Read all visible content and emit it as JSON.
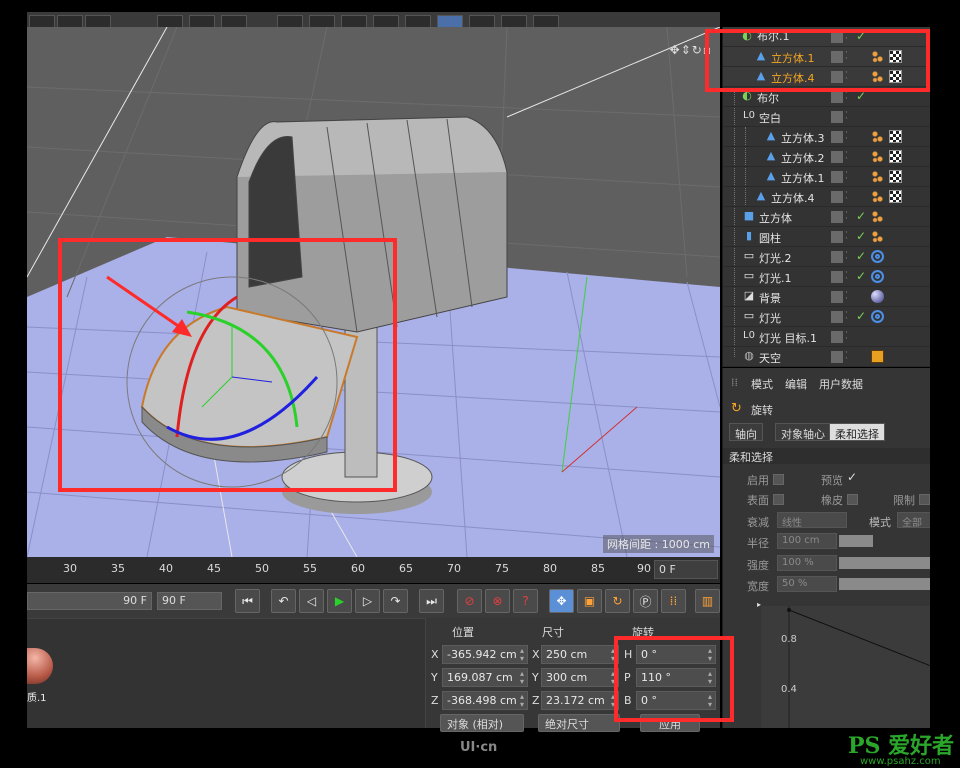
{
  "viewport": {
    "grid_spacing": "网格间距 : 1000 cm"
  },
  "timeline": {
    "ticks": [
      "30",
      "35",
      "40",
      "45",
      "50",
      "55",
      "60",
      "65",
      "70",
      "75",
      "80",
      "85",
      "90"
    ],
    "current_frame": "0 F"
  },
  "transport": {
    "end_frame_slider": "90 F",
    "end_frame_field": "90 F"
  },
  "material": {
    "label": "质.1"
  },
  "coordinates": {
    "headers": {
      "position": "位置",
      "size": "尺寸",
      "rotation": "旋转"
    },
    "rows": [
      {
        "axis": "X",
        "position": "-365.942 cm",
        "size_axis": "X",
        "size": "250 cm",
        "rot_axis": "H",
        "rotation": "0 °"
      },
      {
        "axis": "Y",
        "position": "169.087 cm",
        "size_axis": "Y",
        "size": "300 cm",
        "rot_axis": "P",
        "rotation": "110 °"
      },
      {
        "axis": "Z",
        "position": "-368.498 cm",
        "size_axis": "Z",
        "size": "23.172 cm",
        "rot_axis": "B",
        "rotation": "0 °"
      }
    ],
    "mode_dropdown": "对象 (相对)",
    "size_dropdown": "绝对尺寸",
    "apply_button": "应用"
  },
  "objects": [
    {
      "name": "布尔.1",
      "style": "normal",
      "icon": "boolean-icon",
      "tags": []
    },
    {
      "name": "立方体.1",
      "style": "orange",
      "icon": "polygon-object-icon",
      "tags": [
        "phong",
        "checker"
      ]
    },
    {
      "name": "立方体.4",
      "style": "orange",
      "icon": "polygon-object-icon",
      "tags": [
        "phong",
        "checker"
      ]
    },
    {
      "name": "布尔",
      "style": "normal",
      "icon": "boolean-icon",
      "tags": []
    },
    {
      "name": "空白",
      "style": "normal",
      "icon": "null-object-icon",
      "tags": []
    },
    {
      "name": "立方体.3",
      "style": "normal",
      "icon": "polygon-object-icon",
      "tags": [
        "phong",
        "checker"
      ]
    },
    {
      "name": "立方体.2",
      "style": "normal",
      "icon": "polygon-object-icon",
      "tags": [
        "phong",
        "checker"
      ]
    },
    {
      "name": "立方体.1",
      "style": "normal",
      "icon": "polygon-object-icon",
      "tags": [
        "phong",
        "checker"
      ]
    },
    {
      "name": "立方体.4",
      "style": "normal",
      "icon": "polygon-object-icon",
      "tags": [
        "phong",
        "checker"
      ]
    },
    {
      "name": "立方体",
      "style": "normal",
      "icon": "cube-icon",
      "tags": [
        "phong"
      ]
    },
    {
      "name": "圆柱",
      "style": "normal",
      "icon": "cylinder-icon",
      "tags": [
        "phong"
      ]
    },
    {
      "name": "灯光.2",
      "style": "normal",
      "icon": "light-icon",
      "tags": [
        "target"
      ]
    },
    {
      "name": "灯光.1",
      "style": "normal",
      "icon": "light-icon",
      "tags": [
        "target"
      ]
    },
    {
      "name": "背景",
      "style": "normal",
      "icon": "background-icon",
      "tags": [
        "sphere"
      ]
    },
    {
      "name": "灯光",
      "style": "normal",
      "icon": "light-icon",
      "tags": [
        "target"
      ]
    },
    {
      "name": "灯光 目标.1",
      "style": "normal",
      "icon": "null-object-icon",
      "tags": []
    },
    {
      "name": "天空",
      "style": "normal",
      "icon": "sky-icon",
      "tags": [
        "clapboard"
      ]
    }
  ],
  "attributes": {
    "menu": [
      "模式",
      "编辑",
      "用户数据"
    ],
    "tool_name": "旋转",
    "tabs": [
      "轴向",
      "对象轴心",
      "柔和选择"
    ],
    "section": "柔和选择",
    "enable_label": "启用",
    "preview_label": "预览",
    "surface_label": "表面",
    "rubber_label": "橡皮",
    "limit_label": "限制",
    "falloff_label": "衰减",
    "falloff_value": "线性",
    "mode_label": "模式",
    "mode_value": "全部",
    "radius_label": "半径",
    "radius_value": "100 cm",
    "strength_label": "强度",
    "strength_value": "100 %",
    "width_label": "宽度",
    "width_value": "50 %",
    "curve_y_labels": [
      "0.8",
      "0.4"
    ]
  },
  "watermarks": {
    "uicn": "UI·cn",
    "ps_logo": "PS 爱好者",
    "ps_site": "www.psahz.com"
  },
  "colors": {
    "selection_orange": "#f5a623",
    "annotation_red": "#ff2a2a",
    "viewport_grey": "#5f5f5f",
    "floor_lavender": "#aab0e8",
    "check_green": "#7ad15b",
    "active_tool_blue": "#5b8fd6"
  }
}
